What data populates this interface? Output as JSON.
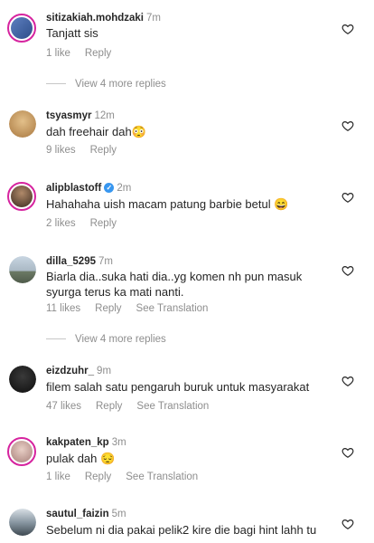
{
  "comments": [
    {
      "username": "sitizakiah.mohdzaki",
      "time": "7m",
      "text": "Tanjatt sis",
      "likes": "1 like",
      "reply": "Reply",
      "translation": "",
      "verified": false,
      "ring": true,
      "avatar_color": "#3a5fa8",
      "heart_icon": "heart-outline-icon"
    },
    {
      "username": "tsyasmyr",
      "time": "12m",
      "text": "dah freehair dah😳",
      "likes": "9 likes",
      "reply": "Reply",
      "translation": "",
      "verified": false,
      "ring": false,
      "avatar_color": "#c89a5a",
      "heart_icon": "heart-outline-icon"
    },
    {
      "username": "alipblastoff",
      "time": "2m",
      "text": "Hahahaha uish macam patung barbie betul 😄",
      "likes": "2 likes",
      "reply": "Reply",
      "translation": "",
      "verified": true,
      "ring": true,
      "avatar_color": "#6b4a2f",
      "heart_icon": "heart-outline-icon"
    },
    {
      "username": "dilla_5295",
      "time": "7m",
      "text": "Biarla dia..suka hati dia..yg komen nh pun masuk syurga terus ka mati nanti.",
      "likes": "11 likes",
      "reply": "Reply",
      "translation": "See Translation",
      "verified": false,
      "ring": false,
      "avatar_color": "#8fa6b8",
      "heart_icon": "heart-outline-icon"
    },
    {
      "username": "eizdzuhr_",
      "time": "9m",
      "text": "filem salah satu pengaruh buruk untuk masyarakat",
      "likes": "47 likes",
      "reply": "Reply",
      "translation": "See Translation",
      "verified": false,
      "ring": false,
      "avatar_color": "#1a1a1a",
      "heart_icon": "heart-outline-icon"
    },
    {
      "username": "kakpaten_kp",
      "time": "3m",
      "text": "pulak dah 😔",
      "likes": "1 like",
      "reply": "Reply",
      "translation": "See Translation",
      "verified": false,
      "ring": true,
      "avatar_color": "#c9a3a0",
      "heart_icon": "heart-outline-icon"
    },
    {
      "username": "sautul_faizin",
      "time": "5m",
      "text": "Sebelum ni dia pakai pelik2 kire die bagi hint lahh tu",
      "likes": "",
      "reply": "",
      "translation": "",
      "verified": false,
      "ring": false,
      "avatar_color": "#55636e",
      "heart_icon": "heart-outline-icon"
    }
  ],
  "view_replies": [
    {
      "label": "View 4 more replies"
    },
    {
      "label": "View 4 more replies"
    }
  ]
}
